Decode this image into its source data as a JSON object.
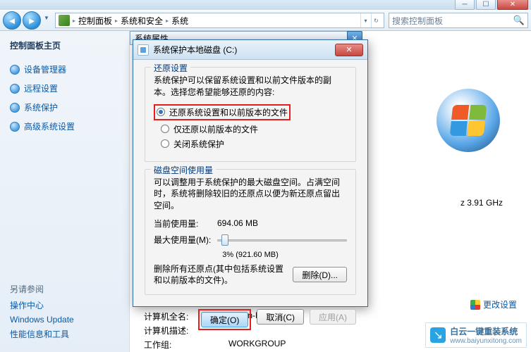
{
  "breadcrumb": {
    "items": [
      "控制面板",
      "系统和安全",
      "系统"
    ]
  },
  "search": {
    "placeholder": "搜索控制面板"
  },
  "sidebar": {
    "title": "控制面板主页",
    "links": [
      "设备管理器",
      "远程设置",
      "系统保护",
      "高级系统设置"
    ],
    "footer_heading": "另请参阅",
    "footer_links": [
      "操作中心",
      "Windows Update",
      "性能信息和工具"
    ]
  },
  "content": {
    "rows": [
      {
        "label": "计算机全名:",
        "value": "Admin-PC"
      },
      {
        "label": "计算机描述:",
        "value": ""
      },
      {
        "label": "工作组:",
        "value": "WORKGROUP"
      }
    ],
    "ghz": "z   3.91 GHz",
    "change_link": "更改设置"
  },
  "sysprop": {
    "title": "系统属性"
  },
  "dialog": {
    "title": "系统保护本地磁盘 (C:)",
    "restore_group": {
      "legend": "还原设置",
      "desc": "系统保护可以保留系统设置和以前文件版本的副本。选择您希望能够还原的内容:",
      "opts": [
        "还原系统设置和以前版本的文件",
        "仅还原以前版本的文件",
        "关闭系统保护"
      ],
      "selected": 0
    },
    "disk_group": {
      "legend": "磁盘空间使用量",
      "desc": "可以调整用于系统保护的最大磁盘空间。占满空间时，系统将删除较旧的还原点以便为新还原点留出空间。",
      "current_label": "当前使用量:",
      "current_value": "694.06 MB",
      "max_label": "最大使用量(M):",
      "slider_caption": "3% (921.60 MB)",
      "delete_desc": "删除所有还原点(其中包括系统设置和以前版本的文件)。",
      "delete_btn": "删除(D)..."
    },
    "buttons": {
      "ok": "确定(O)",
      "cancel": "取消(C)",
      "apply": "应用(A)"
    }
  },
  "watermark": {
    "brand": "白云一键重装系统",
    "url": "www.baiyunxitong.com"
  }
}
